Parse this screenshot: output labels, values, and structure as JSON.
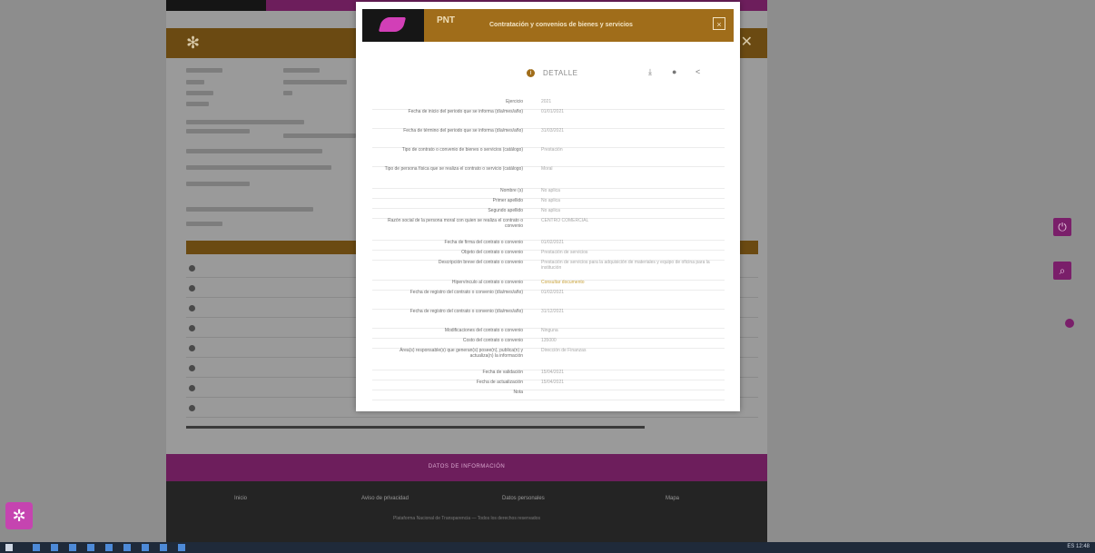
{
  "page": {
    "footer_title": "DATOS DE INFORMACIÓN",
    "footer_links": [
      "Inicio",
      "Aviso de privacidad",
      "Datos personales",
      "Mapa"
    ],
    "footer_copy": "Plataforma Nacional de Transparencia — Todos los derechos reservados"
  },
  "modal": {
    "title": "Contratación y convenios de bienes y servicios",
    "close_label": "×",
    "section_label": "DETALLE",
    "logo_text": "PNT",
    "rows": [
      {
        "label": "Ejercicio",
        "value": "2021"
      },
      {
        "label": "Fecha de inicio del periodo que se informa (día/mes/año)",
        "value": "01/01/2021"
      },
      {
        "label": "Fecha de término del periodo que se informa (día/mes/año)",
        "value": "31/03/2021"
      },
      {
        "label": "Tipo de contrato o convenio de bienes o servicios (catálogo)",
        "value": "Prestación"
      },
      {
        "label": "Tipo de persona física que se realiza el contrato o servicio (catálogo)",
        "value": "Moral"
      },
      {
        "label": "Nombre (s)",
        "value": "No aplica"
      },
      {
        "label": "Primer apellido",
        "value": "No aplica"
      },
      {
        "label": "Segundo apellido",
        "value": "No aplica"
      },
      {
        "label": "Razón social de la persona moral con quien se realiza el contrato o convenio",
        "value": "CENTRO COMERCIAL"
      },
      {
        "label": "Fecha de firma del contrato o convenio",
        "value": "01/02/2021"
      },
      {
        "label": "Objeto del contrato o convenio",
        "value": "Prestación de servicios"
      },
      {
        "label": "Descripción breve del contrato o convenio",
        "value": "Prestación de servicios para la adquisición de materiales y equipo de oficina para la institución"
      },
      {
        "label": "Hipervínculo al contrato o convenio",
        "value": "Consultar documento",
        "link": true
      },
      {
        "label": "Fecha de registro del contrato o convenio (día/mes/año)",
        "value": "01/02/2021"
      },
      {
        "label": "Fecha de registro del contrato o convenio (día/mes/año)",
        "value": "31/12/2021"
      },
      {
        "label": "Modificaciones del contrato o convenio",
        "value": "Ninguna"
      },
      {
        "label": "Costo del contrato o convenio",
        "value": "135000"
      },
      {
        "label": "Área(s) responsable(s) que generan(s) posee(n), publica(n) y actualiza(n) la información",
        "value": "Dirección de Finanzas"
      },
      {
        "label": "Fecha de validación",
        "value": "15/04/2021"
      },
      {
        "label": "Fecha de actualización",
        "value": "15/04/2021"
      },
      {
        "label": "Nota",
        "value": ""
      }
    ]
  },
  "taskbar": {
    "tray_text": "ES  12:48"
  },
  "a11y_icon": "accessibility-icon"
}
